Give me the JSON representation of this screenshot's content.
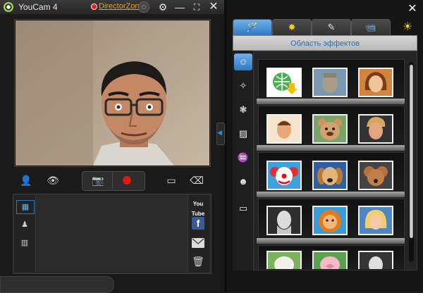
{
  "window": {
    "title": "YouCam 4",
    "director_zone": "DirectorZone"
  },
  "titlebar": {
    "settings_icon": "gear-icon",
    "minimize_icon": "minimize-icon",
    "fullscreen_icon": "fullscreen-icon",
    "close_icon": "close-icon"
  },
  "controls": {
    "add_user_icon": "add-user-icon",
    "eye_icon": "eye-icon",
    "snapshot_icon": "camera-icon",
    "record_icon": "record-icon",
    "screen_icon": "screen-icon",
    "eraser_icon": "eraser-icon"
  },
  "share": {
    "youtube": "You Tube",
    "facebook": "f"
  },
  "effects": {
    "tabs": [
      "effects-tab",
      "frames-tab",
      "draw-tab",
      "surveillance-tab"
    ],
    "header": "Область эффектов",
    "categories": [
      "avatar",
      "magic",
      "particle",
      "distortion",
      "mask",
      "emotion",
      "frame"
    ]
  },
  "colors": {
    "accent": "#2d78c2",
    "record": "#e01515",
    "director_zone": "#f4a01a"
  }
}
